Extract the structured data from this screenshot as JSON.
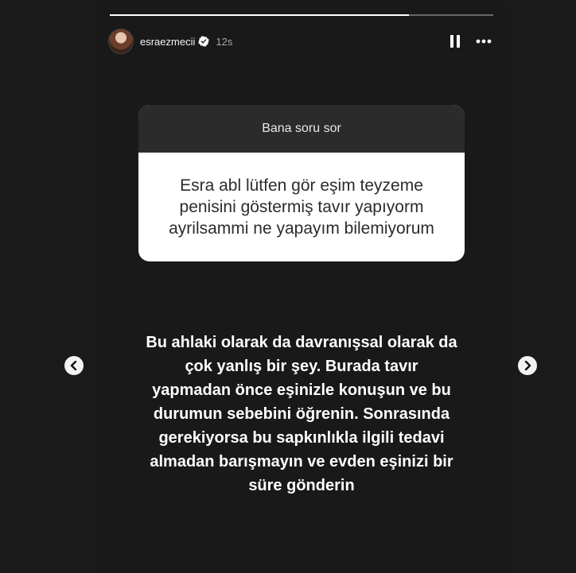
{
  "story": {
    "progress": {
      "total_segments": 1,
      "current_segment": 0,
      "current_fraction": 0.78
    },
    "user": {
      "username": "esraezmecii",
      "time_ago": "12s",
      "verified": true
    },
    "header_icons": {
      "pause": "pause-icon",
      "more": "more-icon",
      "verified": "verified-badge-icon"
    },
    "question_sticker": {
      "prompt": "Bana soru sor",
      "question_lines": [
        "Esra abl lütfen gör eşim teyzeme",
        "penisini göstermiş tavır yapıyorm",
        "ayrilsammi ne yapayım bilemiyorum"
      ]
    },
    "answer_lines": [
      "Bu ahlaki olarak da davranışsal olarak da",
      "çok yanlış bir şey. Burada tavır",
      "yapmadan önce eşinizle konuşun ve bu",
      "durumun sebebini öğrenin. Sonrasında",
      "gerekiyorsa bu sapkınlıkla ilgili tedavi",
      "almadan barışmayın ve evden eşinizi bir",
      "süre gönderin"
    ]
  },
  "navigation": {
    "prev_icon": "chevron-left-icon",
    "next_icon": "chevron-right-icon"
  },
  "colors": {
    "page_bg": "#1a1a1a",
    "story_bg": "#191919",
    "sticker_header": "#2b2b2b",
    "sticker_body": "#ffffff",
    "verified": "#ffffff"
  }
}
